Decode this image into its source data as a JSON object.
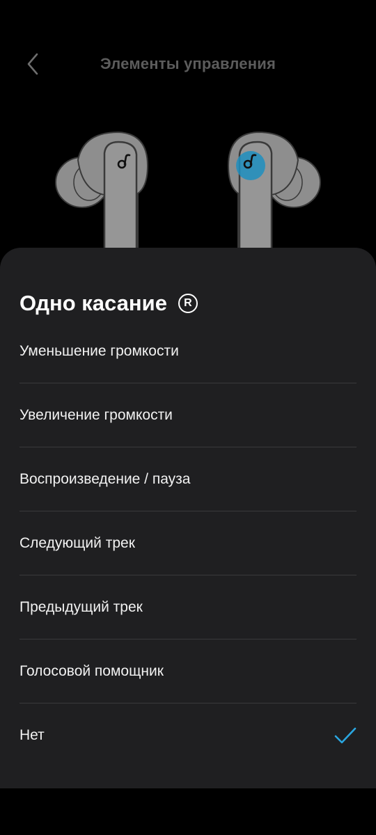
{
  "header": {
    "title": "Элементы управления",
    "back_icon": "chevron-left-icon"
  },
  "earbuds": {
    "left_logo_icon": "soundcore-logo-icon",
    "right_logo_icon": "soundcore-logo-icon",
    "highlighted": "right"
  },
  "sheet": {
    "title": "Одно касание",
    "title_badge": "R",
    "options": [
      {
        "label": "Уменьшение громкости",
        "selected": false
      },
      {
        "label": "Увеличение громкости",
        "selected": false
      },
      {
        "label": "Воспроизведение / пауза",
        "selected": false
      },
      {
        "label": "Следующий трек",
        "selected": false
      },
      {
        "label": "Предыдущий трек",
        "selected": false
      },
      {
        "label": "Голосовой помощник",
        "selected": false
      },
      {
        "label": "Нет",
        "selected": true
      }
    ]
  },
  "colors": {
    "background": "#000000",
    "sheet": "#1f1f21",
    "divider": "#3a3a3c",
    "title_dim": "#5c5c5c",
    "accent": "#2aa6e0",
    "earbud": "#8e8e8e",
    "earbud_outline": "#3a3a3a"
  }
}
